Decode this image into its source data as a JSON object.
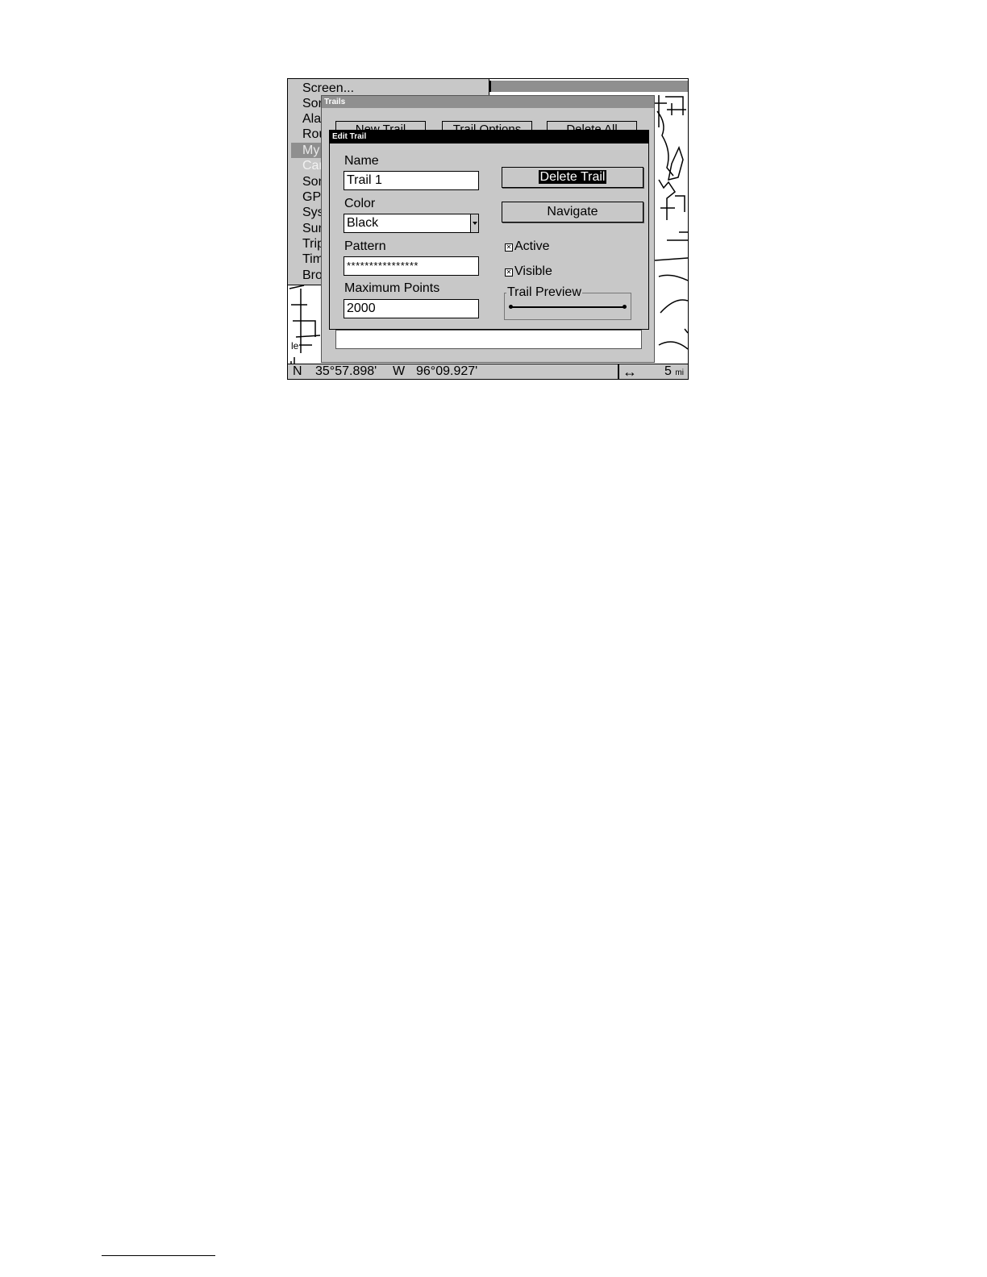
{
  "menu": {
    "items": [
      {
        "label": "Screen...",
        "state": "normal"
      },
      {
        "label": "Sonar",
        "state": "normal"
      },
      {
        "label": "Alarms",
        "state": "normal"
      },
      {
        "label": "Routes",
        "state": "normal"
      },
      {
        "label": "My Trails",
        "state": "selected"
      },
      {
        "label": "Cancel",
        "state": "disabled"
      },
      {
        "label": "Sonar",
        "state": "normal"
      },
      {
        "label": "GPS",
        "state": "normal"
      },
      {
        "label": "System",
        "state": "normal"
      },
      {
        "label": "Sun",
        "state": "normal"
      },
      {
        "label": "Trip",
        "state": "normal"
      },
      {
        "label": "Time",
        "state": "normal"
      },
      {
        "label": "Browse",
        "state": "normal"
      }
    ]
  },
  "trails_dialog": {
    "title": "Trails",
    "new_trail_label": "New Trail",
    "trail_options_label": "Trail Options",
    "delete_all_label": "Delete All"
  },
  "edit_trail": {
    "title": "Edit Trail",
    "name_label": "Name",
    "name_value": "Trail 1",
    "color_label": "Color",
    "color_value": "Black",
    "pattern_label": "Pattern",
    "pattern_value": "****************",
    "max_points_label": "Maximum Points",
    "max_points_value": "2000",
    "delete_trail_label": "Delete Trail",
    "navigate_label": "Navigate",
    "active_label": "Active",
    "active_checked": true,
    "visible_label": "Visible",
    "visible_checked": true,
    "preview_label": "Trail Preview"
  },
  "status_bar": {
    "lat_hemisphere": "N",
    "latitude": "35°57.898'",
    "lon_hemisphere": "W",
    "longitude": "96°09.927'",
    "pan_icon": "double-arrow-icon",
    "zoom_value": "5",
    "zoom_unit": "mi"
  },
  "map_labels": {
    "side_label": "le"
  }
}
